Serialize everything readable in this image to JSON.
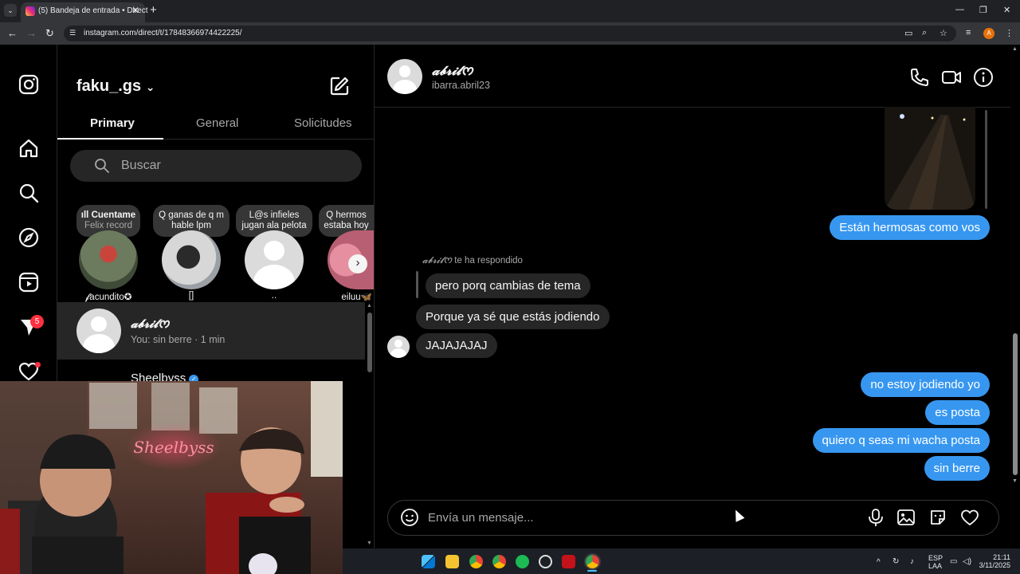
{
  "browser": {
    "tab_title": "(5) Bandeja de entrada • Direct",
    "url": "instagram.com/direct/t/17848366974422225/",
    "tab_list_icon": "chevron-down-icon",
    "profile_initial": "A"
  },
  "rail": {
    "icons": [
      "instagram-logo-icon",
      "home-icon",
      "search-icon",
      "explore-icon",
      "reels-icon",
      "messages-icon",
      "heart-icon"
    ],
    "messages_badge": "5"
  },
  "inbox": {
    "username": "faku_.gs",
    "tabs": [
      {
        "label": "Primary",
        "active": true
      },
      {
        "label": "General",
        "active": false
      },
      {
        "label": "Solicitudes",
        "active": false
      }
    ],
    "search_placeholder": "Buscar",
    "notes": [
      {
        "line1": "ıll Cuentame",
        "line2": "Felix record"
      },
      {
        "line1": "Q ganas de q m",
        "line2": "hable lpm"
      },
      {
        "line1": "L@s infieles",
        "line2": "jugan ala pelota"
      },
      {
        "line1": "Q hermos",
        "line2": "estaba hoy"
      }
    ],
    "stories": [
      {
        "name": "𝓯acundito✪"
      },
      {
        "name": "[]"
      },
      {
        "name": ".."
      },
      {
        "name": "eiluu🦋"
      }
    ],
    "conversations": [
      {
        "name": "𝓪𝓫𝓻𝓲𝓵ᰔ",
        "preview": "You: sin berre · 1 min",
        "selected": true
      },
      {
        "name": "Sheelbyss",
        "preview": "",
        "selected": false
      }
    ]
  },
  "chat": {
    "name": "𝓪𝓫𝓻𝓲𝓵ᰔ",
    "handle": "ibarra.abril23",
    "reply_label_name": "𝓪𝓫𝓻𝓲𝓵ᰔ",
    "reply_label_text": " te ha respondido",
    "messages": [
      {
        "from": "me",
        "text": "Están hermosas como vos"
      },
      {
        "from": "them",
        "text": "pero porq cambias de tema"
      },
      {
        "from": "them",
        "text": "Porque ya sé que estás jodiendo"
      },
      {
        "from": "them",
        "text": "JAJAJAJAJ"
      },
      {
        "from": "me",
        "text": "no estoy jodiendo yo"
      },
      {
        "from": "me",
        "text": "es posta"
      },
      {
        "from": "me",
        "text": "quiero q seas mi wacha posta"
      },
      {
        "from": "me",
        "text": "sin berre"
      }
    ],
    "composer_placeholder": "Envía un mensaje...",
    "header_icons": [
      "phone-icon",
      "video-icon",
      "info-icon"
    ],
    "composer_icons": [
      "emoji-icon",
      "microphone-icon",
      "image-icon",
      "sticker-icon",
      "heart-icon"
    ]
  },
  "overlay": {
    "neon_sign": "Sheelbyss"
  },
  "taskbar": {
    "lang_line1": "ESP",
    "lang_line2": "LAA",
    "time": "21:11",
    "date": "3/11/2025"
  }
}
